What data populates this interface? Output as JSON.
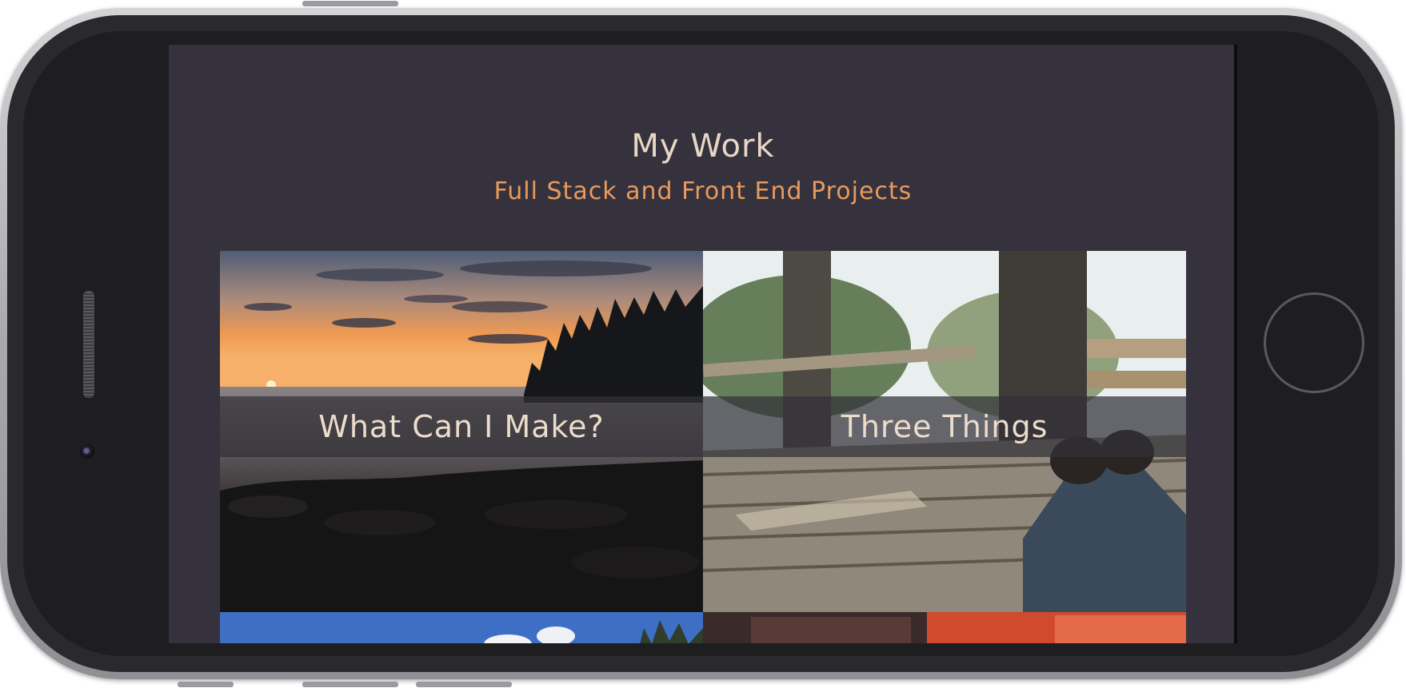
{
  "page": {
    "title": "My Work",
    "subtitle": "Full Stack and Front End Projects"
  },
  "projects": [
    {
      "label": "What Can I Make?",
      "image": "sunset over rocky shoreline"
    },
    {
      "label": "Three Things",
      "image": "treehouse platform with boots"
    },
    {
      "label": "",
      "image": "blue sky and trees"
    },
    {
      "label": "",
      "image": "red car interior"
    }
  ],
  "colors": {
    "background": "#35323d",
    "title": "#e8d7c5",
    "subtitle": "#e99a5c",
    "label": "#ecdccc"
  }
}
